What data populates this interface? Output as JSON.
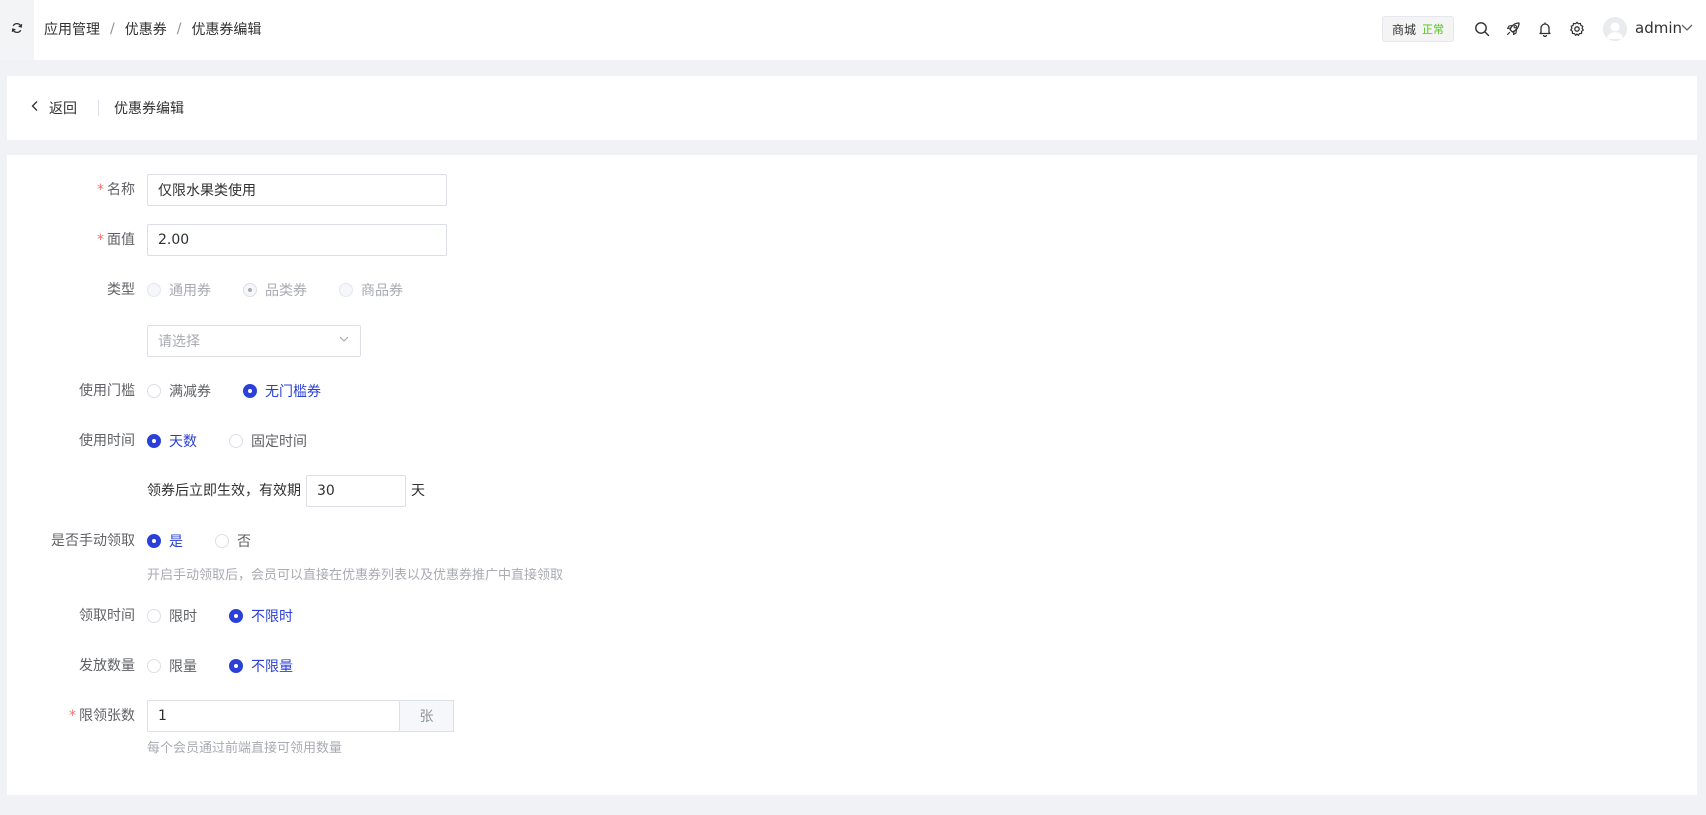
{
  "header": {
    "breadcrumb": [
      "应用管理",
      "优惠券",
      "优惠券编辑"
    ],
    "breadcrumb_separator": "/",
    "shop": {
      "label": "商城",
      "status": "正常"
    },
    "icons": [
      "search-icon",
      "rocket-icon",
      "bell-icon",
      "gear-icon"
    ],
    "user": {
      "name": "admin"
    }
  },
  "page_header": {
    "back_label": "返回",
    "title": "优惠券编辑"
  },
  "form": {
    "name": {
      "label": "名称",
      "value": "仅限水果类使用"
    },
    "face_value": {
      "label": "面值",
      "value": "2.00"
    },
    "type": {
      "label": "类型",
      "options": [
        "通用券",
        "品类券",
        "商品券"
      ],
      "selected": "品类券",
      "disabled": true,
      "select_placeholder": "请选择"
    },
    "threshold": {
      "label": "使用门槛",
      "options": [
        "满减券",
        "无门槛券"
      ],
      "selected": "无门槛券"
    },
    "use_time": {
      "label": "使用时间",
      "options": [
        "天数",
        "固定时间"
      ],
      "selected": "天数",
      "validity_prefix": "领券后立即生效，有效期",
      "validity_days": "30",
      "validity_suffix": "天"
    },
    "manual_claim": {
      "label": "是否手动领取",
      "options": [
        "是",
        "否"
      ],
      "selected": "是",
      "hint": "开启手动领取后，会员可以直接在优惠券列表以及优惠券推广中直接领取"
    },
    "claim_time": {
      "label": "领取时间",
      "options": [
        "限时",
        "不限时"
      ],
      "selected": "不限时"
    },
    "issue_quantity": {
      "label": "发放数量",
      "options": [
        "限量",
        "不限量"
      ],
      "selected": "不限量"
    },
    "limit_per_member": {
      "label": "限领张数",
      "value": "1",
      "unit": "张",
      "hint": "每个会员通过前端直接可领用数量"
    }
  },
  "colors": {
    "primary": "#2a40d8",
    "required": "#f56c6c",
    "status_ok": "#52c41a"
  }
}
